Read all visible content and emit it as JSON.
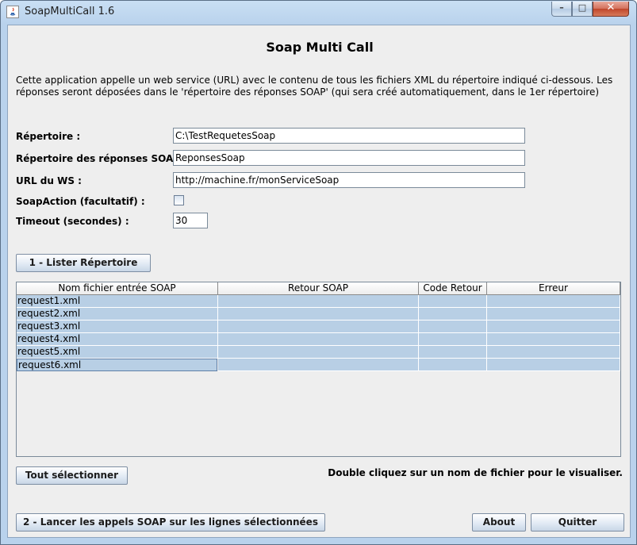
{
  "window": {
    "title": "SoapMultiCall 1.6",
    "controls": {
      "minimize": "–",
      "maximize": "□",
      "close": "✕"
    }
  },
  "header": {
    "title": "Soap Multi Call"
  },
  "description": "Cette application appelle un web service (URL) avec le contenu de tous les fichiers XML du répertoire indiqué ci-dessous. Les réponses seront déposées dans le 'répertoire des réponses SOAP' (qui sera créé automatiquement, dans le 1er répertoire)",
  "form": {
    "repertoire_label": "Répertoire :",
    "repertoire_value": "C:\\TestRequetesSoap",
    "reponses_label": "Répertoire des réponses SOAP :",
    "reponses_value": "ReponsesSoap",
    "url_label": "URL du WS :",
    "url_value": "http://machine.fr/monServiceSoap",
    "soapaction_label": "SoapAction (facultatif) :",
    "soapaction_checked": false,
    "timeout_label": "Timeout (secondes) :",
    "timeout_value": "30"
  },
  "buttons": {
    "lister": "1 - Lister Répertoire",
    "tout_selectionner": "Tout sélectionner",
    "lancer": "2 - Lancer les appels SOAP sur les lignes sélectionnées",
    "about": "About",
    "quitter": "Quitter"
  },
  "table": {
    "columns": [
      "Nom fichier entrée SOAP",
      "Retour SOAP",
      "Code Retour",
      "Erreur"
    ],
    "rows": [
      [
        "request1.xml",
        "",
        "",
        ""
      ],
      [
        "request2.xml",
        "",
        "",
        ""
      ],
      [
        "request3.xml",
        "",
        "",
        ""
      ],
      [
        "request4.xml",
        "",
        "",
        ""
      ],
      [
        "request5.xml",
        "",
        "",
        ""
      ],
      [
        "request6.xml",
        "",
        "",
        ""
      ]
    ],
    "selection_color": "#b8cfe5"
  },
  "hint": "Double cliquez sur un nom de fichier pour le visualiser."
}
